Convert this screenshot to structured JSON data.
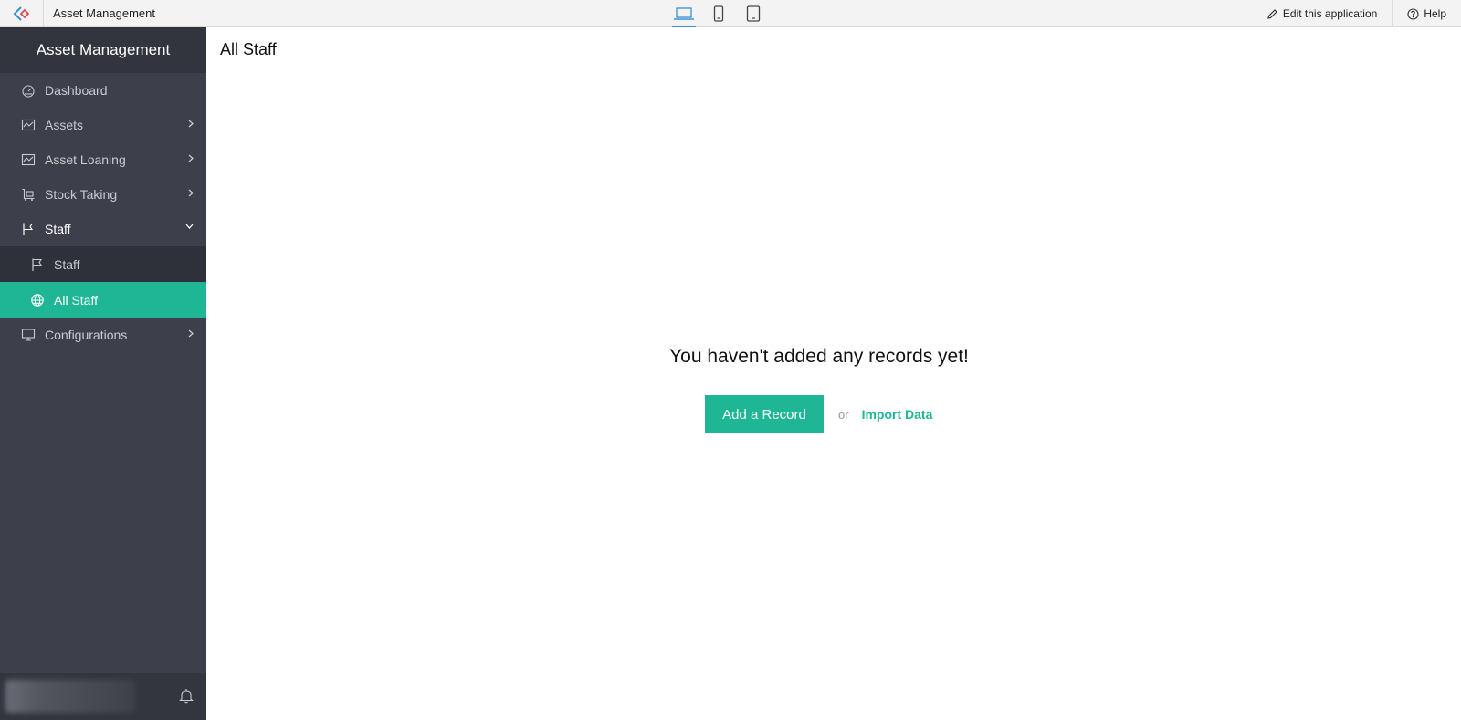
{
  "topbar": {
    "app_name": "Asset Management",
    "edit_label": "Edit this application",
    "help_label": "Help",
    "devices": [
      "laptop-icon",
      "mobile-icon",
      "tablet-icon"
    ]
  },
  "sidebar": {
    "title": "Asset Management",
    "items": [
      {
        "label": "Dashboard",
        "icon": "dashboard-icon"
      },
      {
        "label": "Assets",
        "icon": "chart-icon"
      },
      {
        "label": "Asset Loaning",
        "icon": "chart-icon"
      },
      {
        "label": "Stock Taking",
        "icon": "cart-icon"
      },
      {
        "label": "Staff",
        "icon": "flag-icon"
      },
      {
        "label": "Configurations",
        "icon": "monitor-icon"
      }
    ],
    "sub_items": [
      {
        "label": "Staff",
        "icon": "flag-icon"
      },
      {
        "label": "All Staff",
        "icon": "globe-icon"
      }
    ]
  },
  "main": {
    "title": "All Staff",
    "empty_message": "You haven't added any records yet!",
    "add_button": "Add a Record",
    "or_text": "or",
    "import_link": "Import Data"
  },
  "colors": {
    "accent": "#1fb696",
    "sidebar_bg": "#3d3f4a",
    "sidebar_header": "#32343e",
    "topbar_bg": "#f3f3f3",
    "device_active": "#3a8fd9"
  }
}
